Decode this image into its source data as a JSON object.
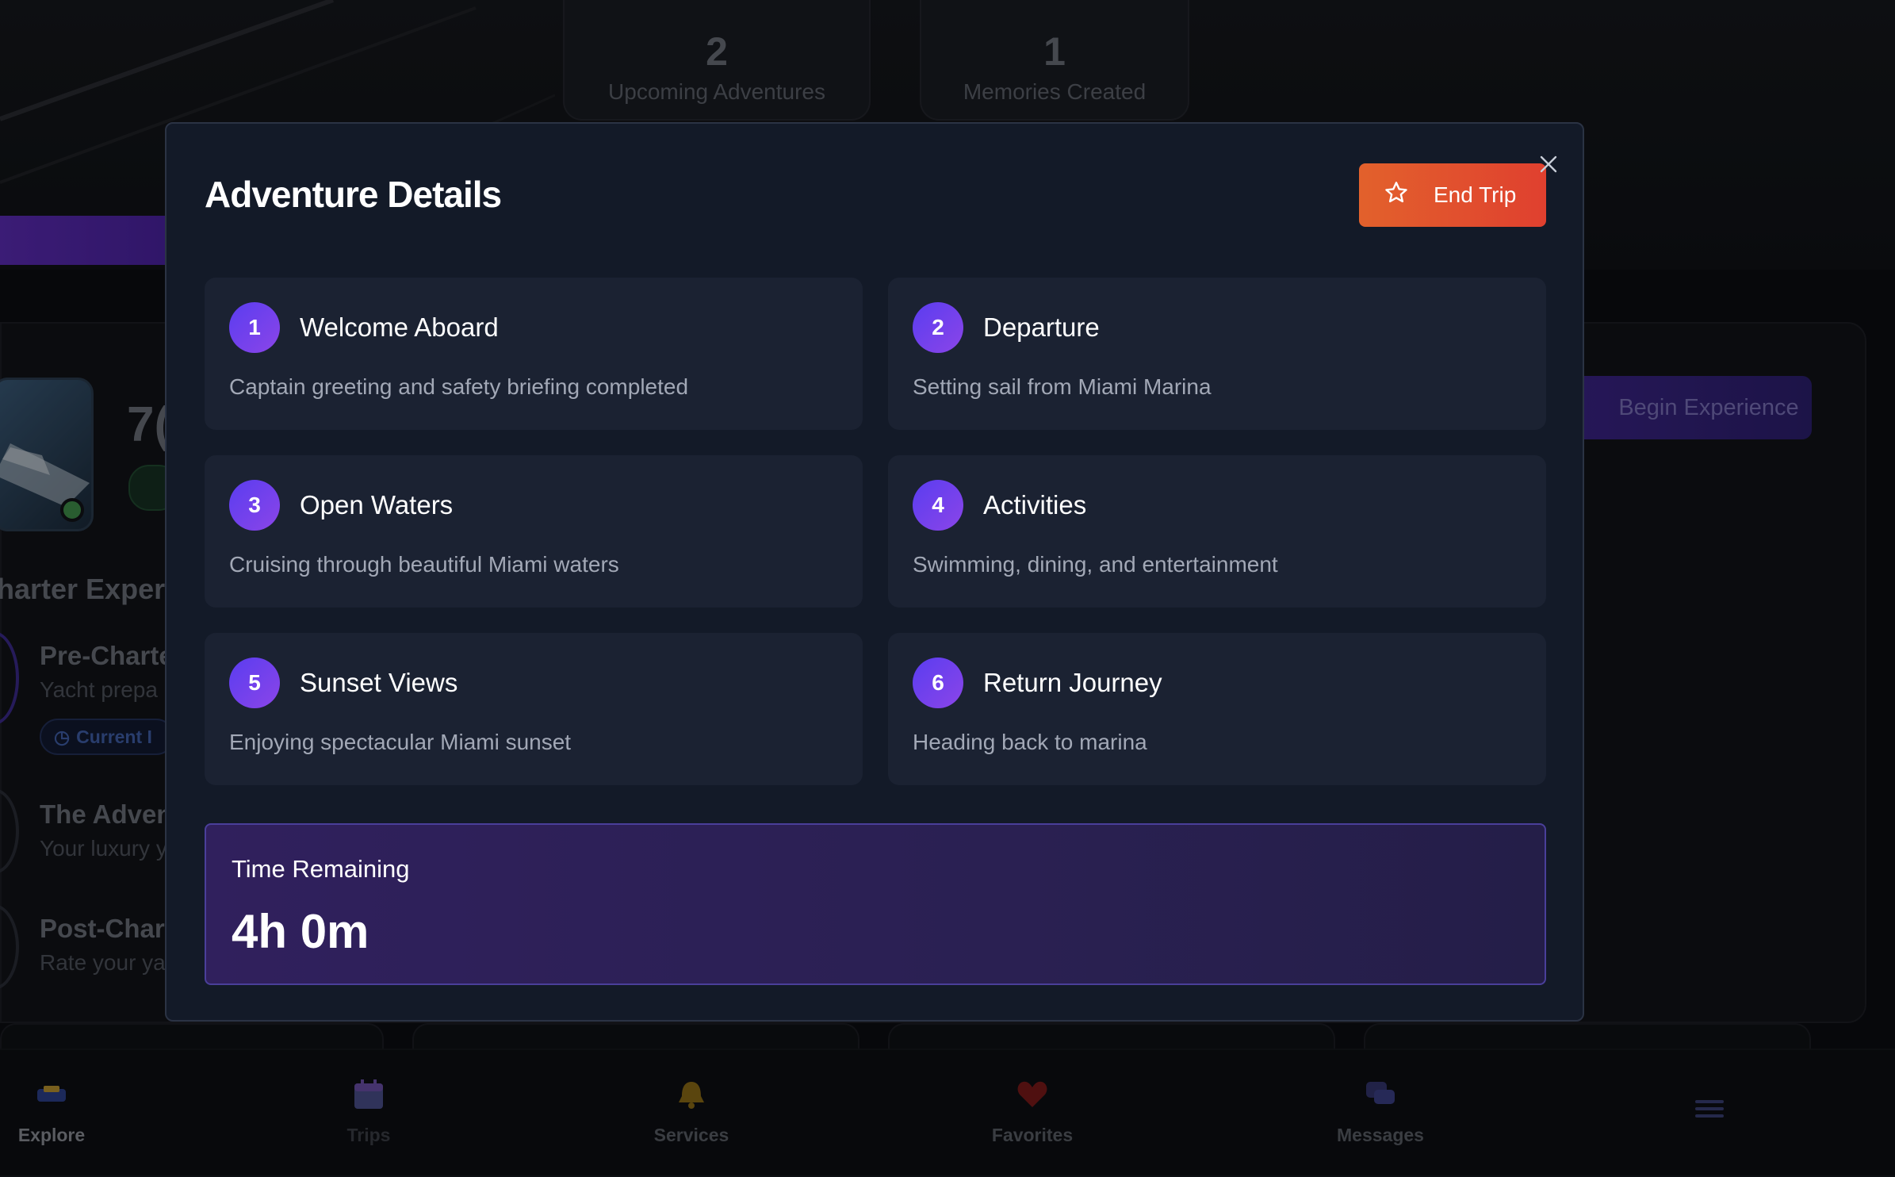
{
  "background": {
    "stats": [
      {
        "value": "2",
        "label": "Upcoming Adventures"
      },
      {
        "value": "1",
        "label": "Memories Created"
      }
    ],
    "yacht_number": "7(",
    "begin_button": "Begin Experience",
    "section_title": "harter Exper",
    "timeline": [
      {
        "title": "Pre-Charte",
        "subtitle": "Yacht prepa",
        "badge": "Current I"
      },
      {
        "title": "The Adven",
        "subtitle": "Your luxury y"
      },
      {
        "title": "Post-Chart",
        "subtitle": "Rate your ya"
      }
    ]
  },
  "tabbar": {
    "items": [
      {
        "label": "Explore",
        "icon": "compass-icon"
      },
      {
        "label": "Trips",
        "icon": "calendar-icon"
      },
      {
        "label": "Services",
        "icon": "bell-icon"
      },
      {
        "label": "Favorites",
        "icon": "heart-icon"
      },
      {
        "label": "Messages",
        "icon": "chat-icon"
      },
      {
        "label": "",
        "icon": "menu-icon"
      }
    ]
  },
  "modal": {
    "title": "Adventure Details",
    "end_trip_label": "End Trip",
    "close_icon": "close-icon",
    "steps": [
      {
        "number": "1",
        "title": "Welcome Aboard",
        "description": "Captain greeting and safety briefing completed"
      },
      {
        "number": "2",
        "title": "Departure",
        "description": "Setting sail from Miami Marina"
      },
      {
        "number": "3",
        "title": "Open Waters",
        "description": "Cruising through beautiful Miami waters"
      },
      {
        "number": "4",
        "title": "Activities",
        "description": "Swimming, dining, and entertainment"
      },
      {
        "number": "5",
        "title": "Sunset Views",
        "description": "Enjoying spectacular Miami sunset"
      },
      {
        "number": "6",
        "title": "Return Journey",
        "description": "Heading back to marina"
      }
    ],
    "time_remaining": {
      "label": "Time Remaining",
      "value": "4h 0m"
    }
  },
  "colors": {
    "accent_orange": "#e2612c",
    "accent_purple": "#7b45ea",
    "modal_bg": "#131a28"
  }
}
